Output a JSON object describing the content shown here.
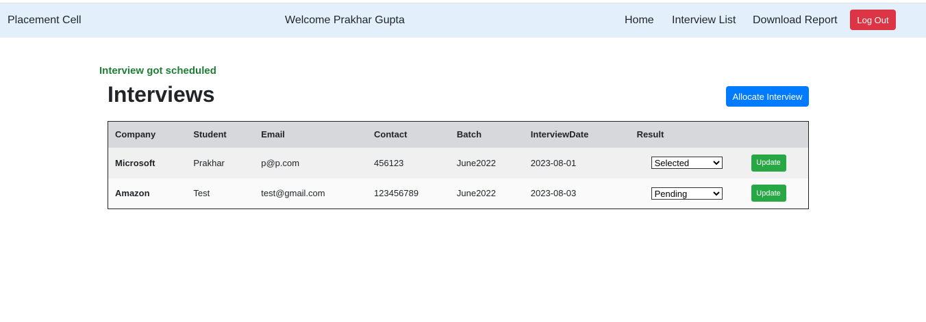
{
  "navbar": {
    "brand": "Placement Cell",
    "welcome": "Welcome Prakhar Gupta",
    "links": [
      "Home",
      "Interview List",
      "Download Report"
    ],
    "logout_label": "Log Out"
  },
  "flash_message": "Interview got scheduled",
  "page": {
    "title": "Interviews",
    "allocate_label": "Allocate Interview"
  },
  "table": {
    "headers": [
      "Company",
      "Student",
      "Email",
      "Contact",
      "Batch",
      "InterviewDate",
      "Result"
    ],
    "rows": [
      {
        "company": "Microsoft",
        "student": "Prakhar",
        "email": "p@p.com",
        "contact": "456123",
        "batch": "June2022",
        "date": "2023-08-01",
        "result": "Selected",
        "update_label": "Update"
      },
      {
        "company": "Amazon",
        "student": "Test",
        "email": "test@gmail.com",
        "contact": "123456789",
        "batch": "June2022",
        "date": "2023-08-03",
        "result": "Pending",
        "update_label": "Update"
      }
    ]
  },
  "colors": {
    "navbar_bg": "#e3f0fb",
    "logout": "#dc3545",
    "allocate": "#007bff",
    "update": "#28a745",
    "flash": "#1e7e34"
  }
}
